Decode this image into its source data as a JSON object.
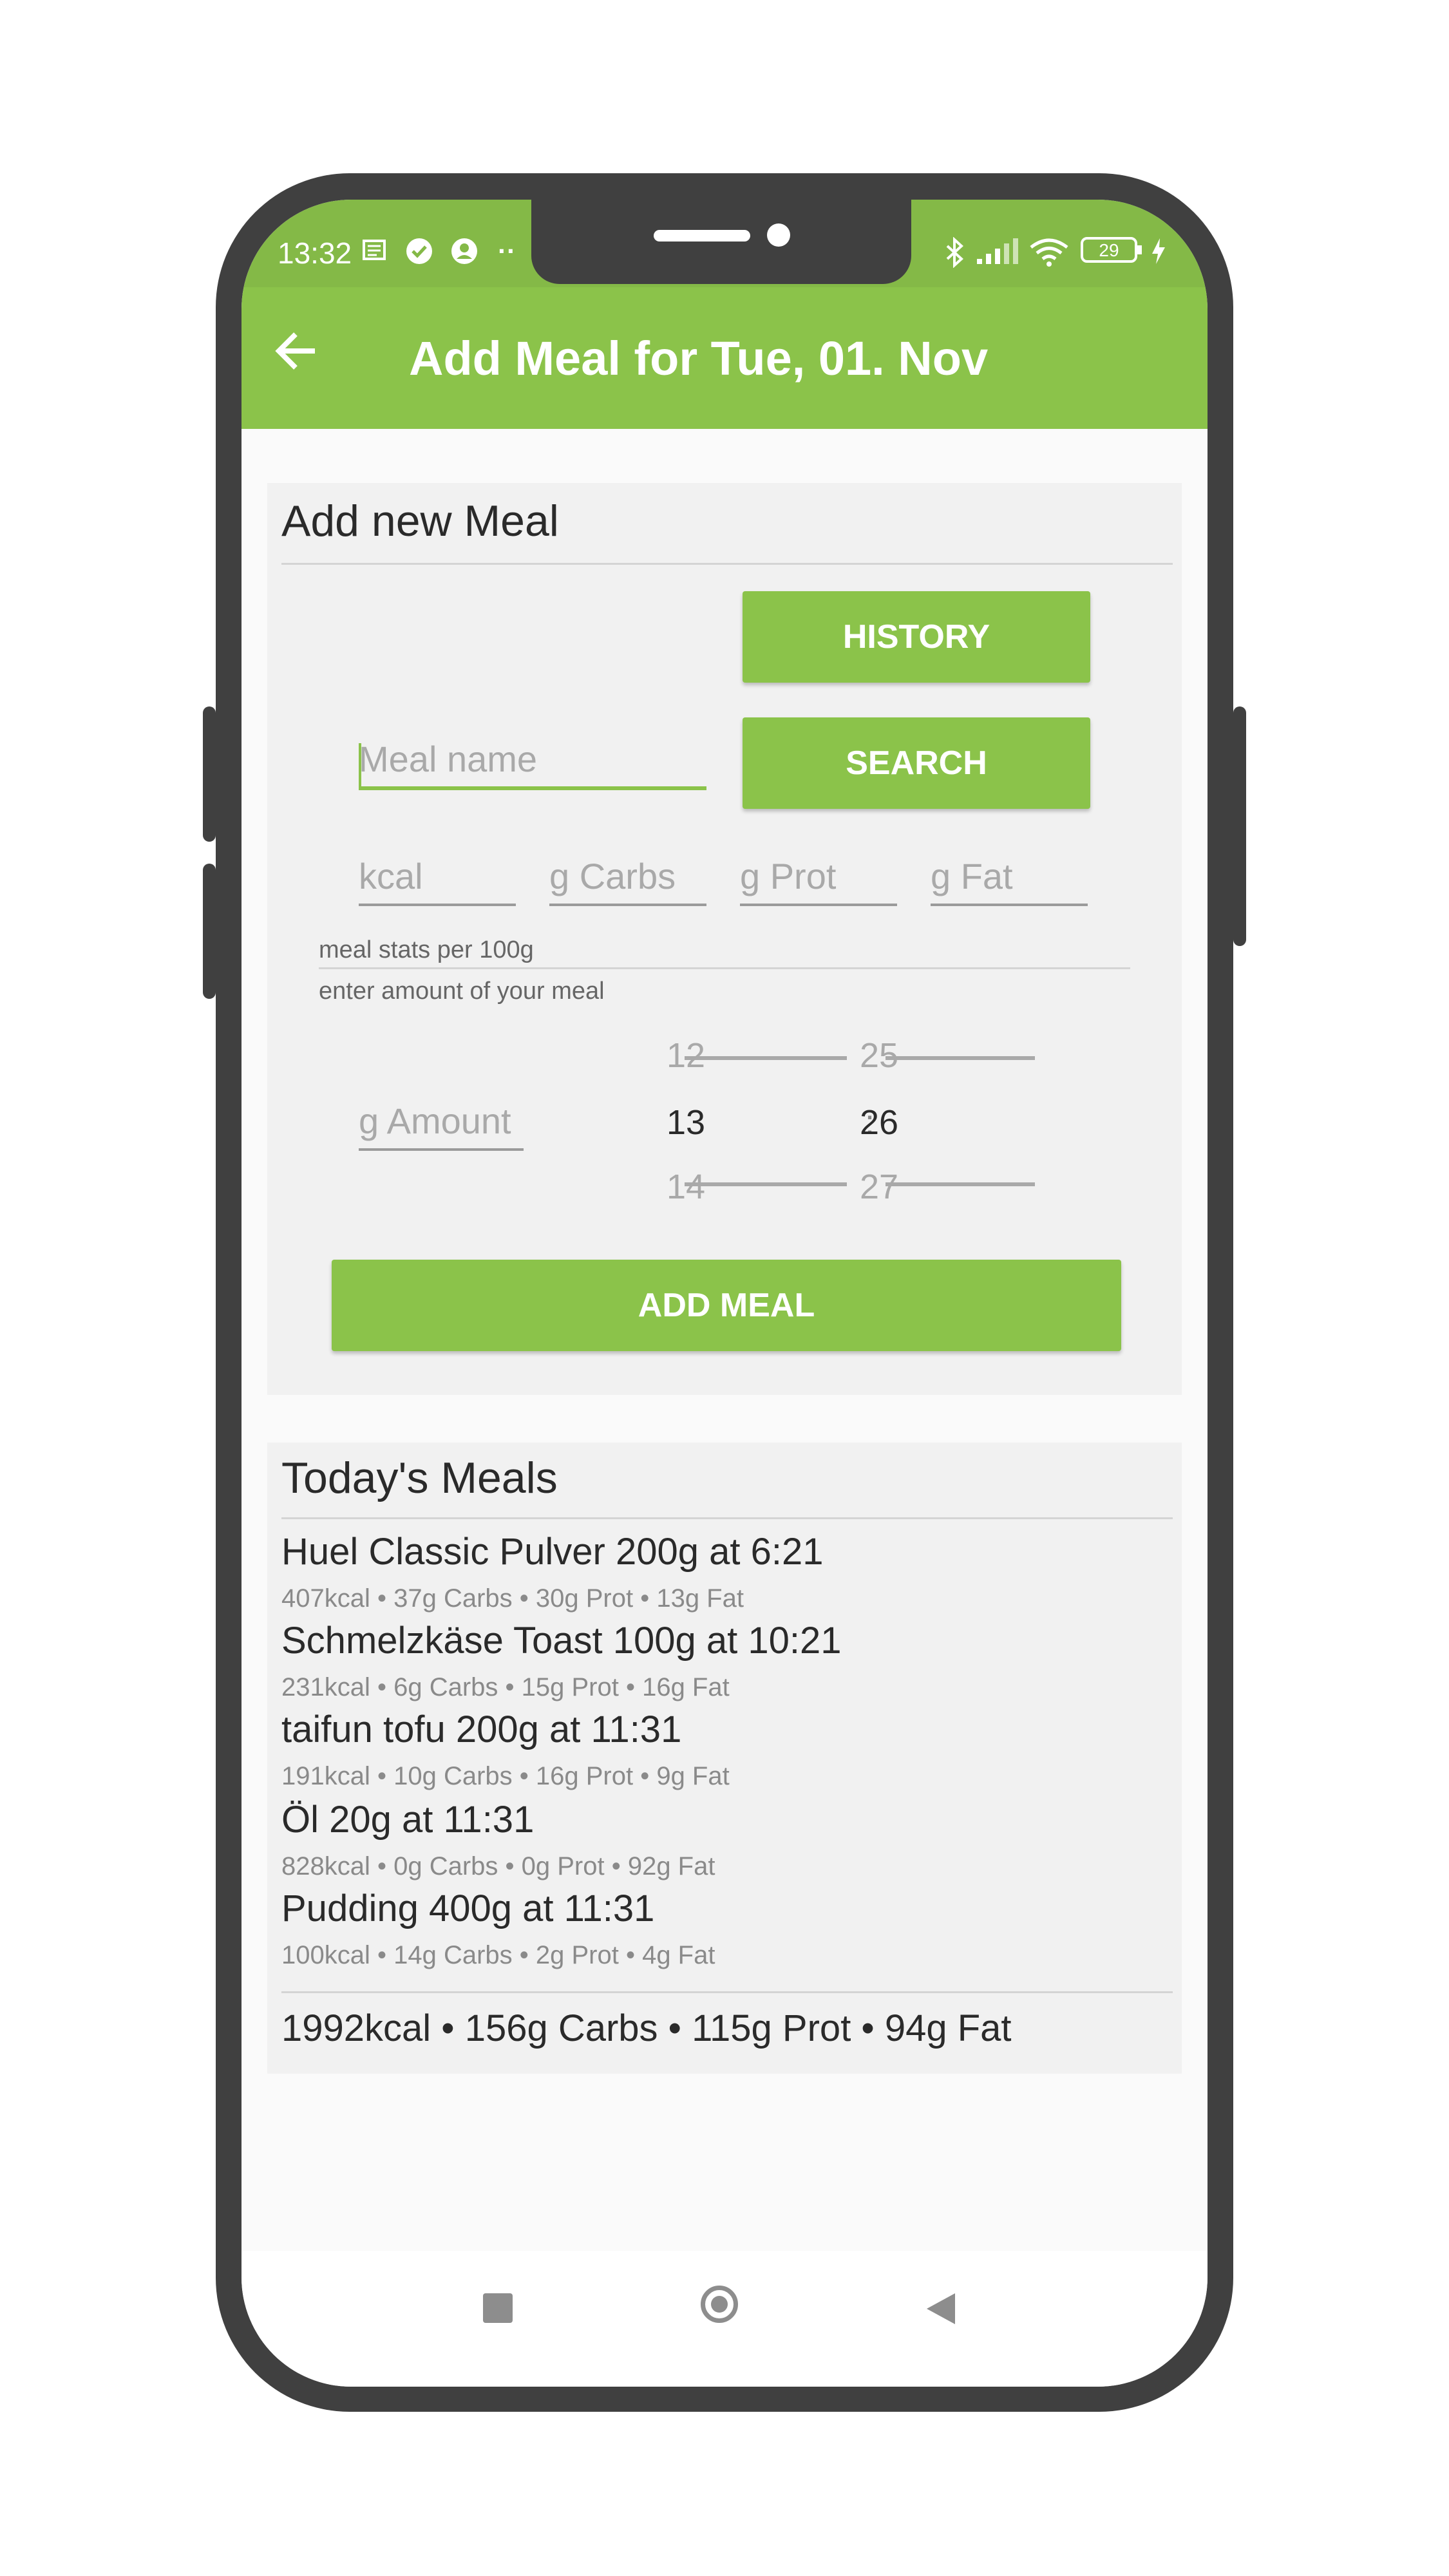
{
  "status_bar": {
    "time": "13:32",
    "more": "··",
    "battery": "29"
  },
  "app_bar": {
    "title": "Add Meal for Tue, 01. Nov"
  },
  "add_meal_card": {
    "title": "Add new Meal",
    "history_button": "HISTORY",
    "search_button": "SEARCH",
    "meal_name_placeholder": "Meal name",
    "kcal_placeholder": "kcal",
    "carbs_placeholder": "g Carbs",
    "prot_placeholder": "g Prot",
    "fat_placeholder": "g Fat",
    "per_100g_label": "meal stats per 100g",
    "amount_label": "enter amount of your meal",
    "amount_placeholder": "g Amount",
    "time_picker": {
      "hour_prev": "12",
      "hour": "13",
      "hour_next": "14",
      "separator": ":",
      "minute_prev": "25",
      "minute": "26",
      "minute_next": "27"
    },
    "add_button": "ADD MEAL"
  },
  "todays_meals": {
    "title": "Today's Meals",
    "meals": [
      {
        "name": "Huel Classic Pulver 200g at 6:21",
        "stats": "407kcal  • 37g Carbs • 30g Prot • 13g Fat"
      },
      {
        "name": "Schmelzkäse Toast 100g at 10:21",
        "stats": "231kcal  • 6g Carbs • 15g Prot • 16g Fat"
      },
      {
        "name": "taifun tofu 200g at 11:31",
        "stats": "191kcal  • 10g Carbs • 16g Prot • 9g Fat"
      },
      {
        "name": "Öl 20g at 11:31",
        "stats": "828kcal  • 0g Carbs • 0g Prot • 92g Fat"
      },
      {
        "name": "Pudding 400g at 11:31",
        "stats": "100kcal  • 14g Carbs • 2g Prot • 4g Fat"
      }
    ],
    "total": "1992kcal  • 156g Carbs • 115g Prot • 94g Fat"
  },
  "colors": {
    "accent": "#8bc34a",
    "status_bar": "#84b947",
    "frame": "#404040"
  }
}
